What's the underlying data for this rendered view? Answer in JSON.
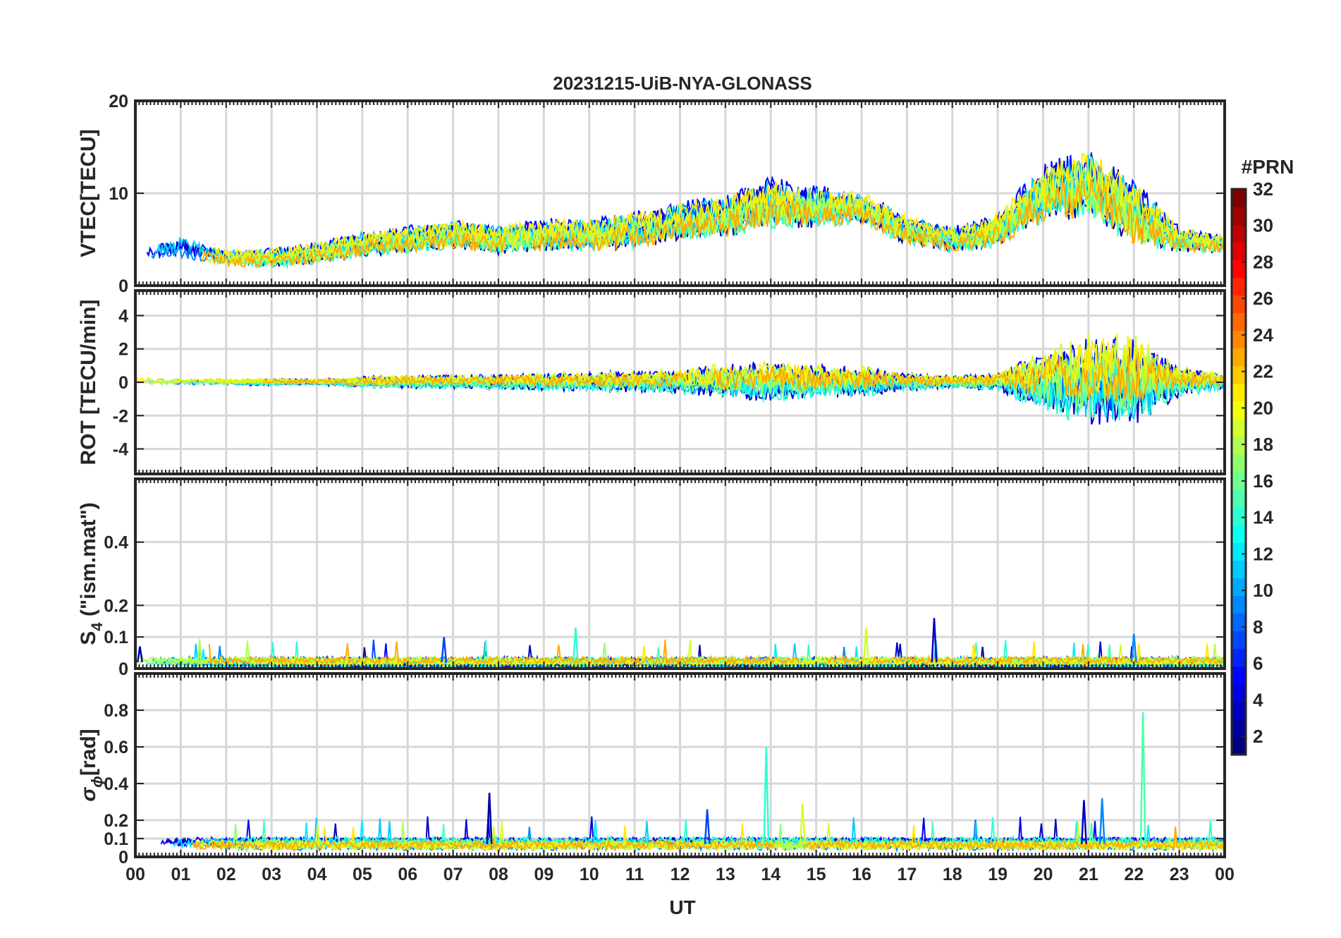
{
  "chart_data": {
    "type": "line",
    "title": "20231215-UiB-NYA-GLONASS",
    "xlabel": "UT",
    "x_tick_labels": [
      "00",
      "01",
      "02",
      "03",
      "04",
      "05",
      "06",
      "07",
      "08",
      "09",
      "10",
      "11",
      "12",
      "13",
      "14",
      "15",
      "16",
      "17",
      "18",
      "19",
      "20",
      "21",
      "22",
      "23",
      "00"
    ],
    "xlim": [
      0,
      24
    ],
    "grid": true,
    "colorbar": {
      "label": "#PRN",
      "colormap": "jet",
      "range": [
        1,
        32
      ],
      "tick_labels": [
        "2",
        "4",
        "6",
        "8",
        "10",
        "12",
        "14",
        "16",
        "18",
        "20",
        "22",
        "24",
        "26",
        "28",
        "30",
        "32"
      ]
    },
    "panels": [
      {
        "ylabel_text": "VTEC[TECU]",
        "ylim": [
          0,
          20
        ],
        "y_ticks": [
          0,
          10,
          20
        ],
        "y_tick_labels": [
          "0",
          "10",
          "20"
        ],
        "activity": [
          [
            0,
            3
          ],
          [
            1,
            4
          ],
          [
            2,
            3
          ],
          [
            3,
            3
          ],
          [
            4,
            3.5
          ],
          [
            5,
            4.5
          ],
          [
            6,
            5
          ],
          [
            7,
            5.5
          ],
          [
            8,
            5
          ],
          [
            9,
            5.5
          ],
          [
            10,
            5.5
          ],
          [
            11,
            6
          ],
          [
            12,
            7
          ],
          [
            13,
            7.5
          ],
          [
            14,
            9
          ],
          [
            15,
            8.5
          ],
          [
            16,
            8.5
          ],
          [
            17,
            6
          ],
          [
            18,
            5
          ],
          [
            19,
            6
          ],
          [
            20,
            10
          ],
          [
            21,
            11
          ],
          [
            22,
            8
          ],
          [
            23,
            5
          ],
          [
            24,
            4.5
          ]
        ],
        "spread": [
          [
            0,
            1
          ],
          [
            1,
            1.5
          ],
          [
            2,
            1
          ],
          [
            5,
            1.5
          ],
          [
            10,
            2
          ],
          [
            13,
            2.5
          ],
          [
            14,
            3
          ],
          [
            16,
            2
          ],
          [
            18,
            1.5
          ],
          [
            19,
            2
          ],
          [
            20,
            3.5
          ],
          [
            21,
            4
          ],
          [
            22,
            4
          ],
          [
            23,
            1.5
          ],
          [
            24,
            1
          ]
        ]
      },
      {
        "ylabel_text": "ROT [TECU/min]",
        "ylim": [
          -5.5,
          5.5
        ],
        "y_ticks": [
          -4,
          -2,
          0,
          2,
          4
        ],
        "y_tick_labels": [
          "-4",
          "-2",
          "0",
          "2",
          "4"
        ],
        "activity": [
          [
            0,
            0
          ],
          [
            24,
            0
          ]
        ],
        "spread": [
          [
            0,
            0.3
          ],
          [
            4,
            0.2
          ],
          [
            5,
            0.4
          ],
          [
            8,
            0.5
          ],
          [
            12,
            0.8
          ],
          [
            13,
            1.2
          ],
          [
            14,
            1.3
          ],
          [
            16,
            1.0
          ],
          [
            17,
            0.6
          ],
          [
            18,
            0.4
          ],
          [
            19,
            0.6
          ],
          [
            20,
            2.0
          ],
          [
            21,
            3.0
          ],
          [
            22,
            3.0
          ],
          [
            23,
            1.0
          ],
          [
            24,
            0.5
          ]
        ]
      },
      {
        "ylabel_main": "S",
        "ylabel_sub": "4",
        "ylabel_rest": " (\"ism.mat\")",
        "ylim": [
          0,
          0.6
        ],
        "y_ticks": [
          0,
          0.1,
          0.2,
          0.4
        ],
        "y_tick_labels": [
          "0",
          "0.1",
          "0.2",
          "0.4"
        ],
        "activity": [
          [
            0,
            0.02
          ],
          [
            24,
            0.02
          ]
        ],
        "spread": [
          [
            0,
            0.02
          ],
          [
            24,
            0.02
          ]
        ],
        "spikes": [
          [
            0.1,
            0.07
          ],
          [
            6.8,
            0.1
          ],
          [
            9.7,
            0.13
          ],
          [
            16.1,
            0.13
          ],
          [
            17.6,
            0.16
          ],
          [
            22.0,
            0.11
          ]
        ]
      },
      {
        "ylabel_main": "σ",
        "ylabel_sub": "ϕ",
        "ylabel_rest": "[rad]",
        "ylim": [
          0,
          1
        ],
        "y_ticks": [
          0,
          0.1,
          0.2,
          0.4,
          0.6,
          0.8
        ],
        "y_tick_labels": [
          "0",
          "0.1",
          "0.2",
          "0.4",
          "0.6",
          "0.8"
        ],
        "activity": [
          [
            0,
            0.07
          ],
          [
            24,
            0.07
          ]
        ],
        "spread": [
          [
            0,
            0.04
          ],
          [
            24,
            0.04
          ]
        ],
        "spikes": [
          [
            7.8,
            0.35
          ],
          [
            12.6,
            0.26
          ],
          [
            13.9,
            0.6
          ],
          [
            14.7,
            0.29
          ],
          [
            20.9,
            0.31
          ],
          [
            21.3,
            0.32
          ],
          [
            22.2,
            0.79
          ]
        ]
      }
    ]
  }
}
